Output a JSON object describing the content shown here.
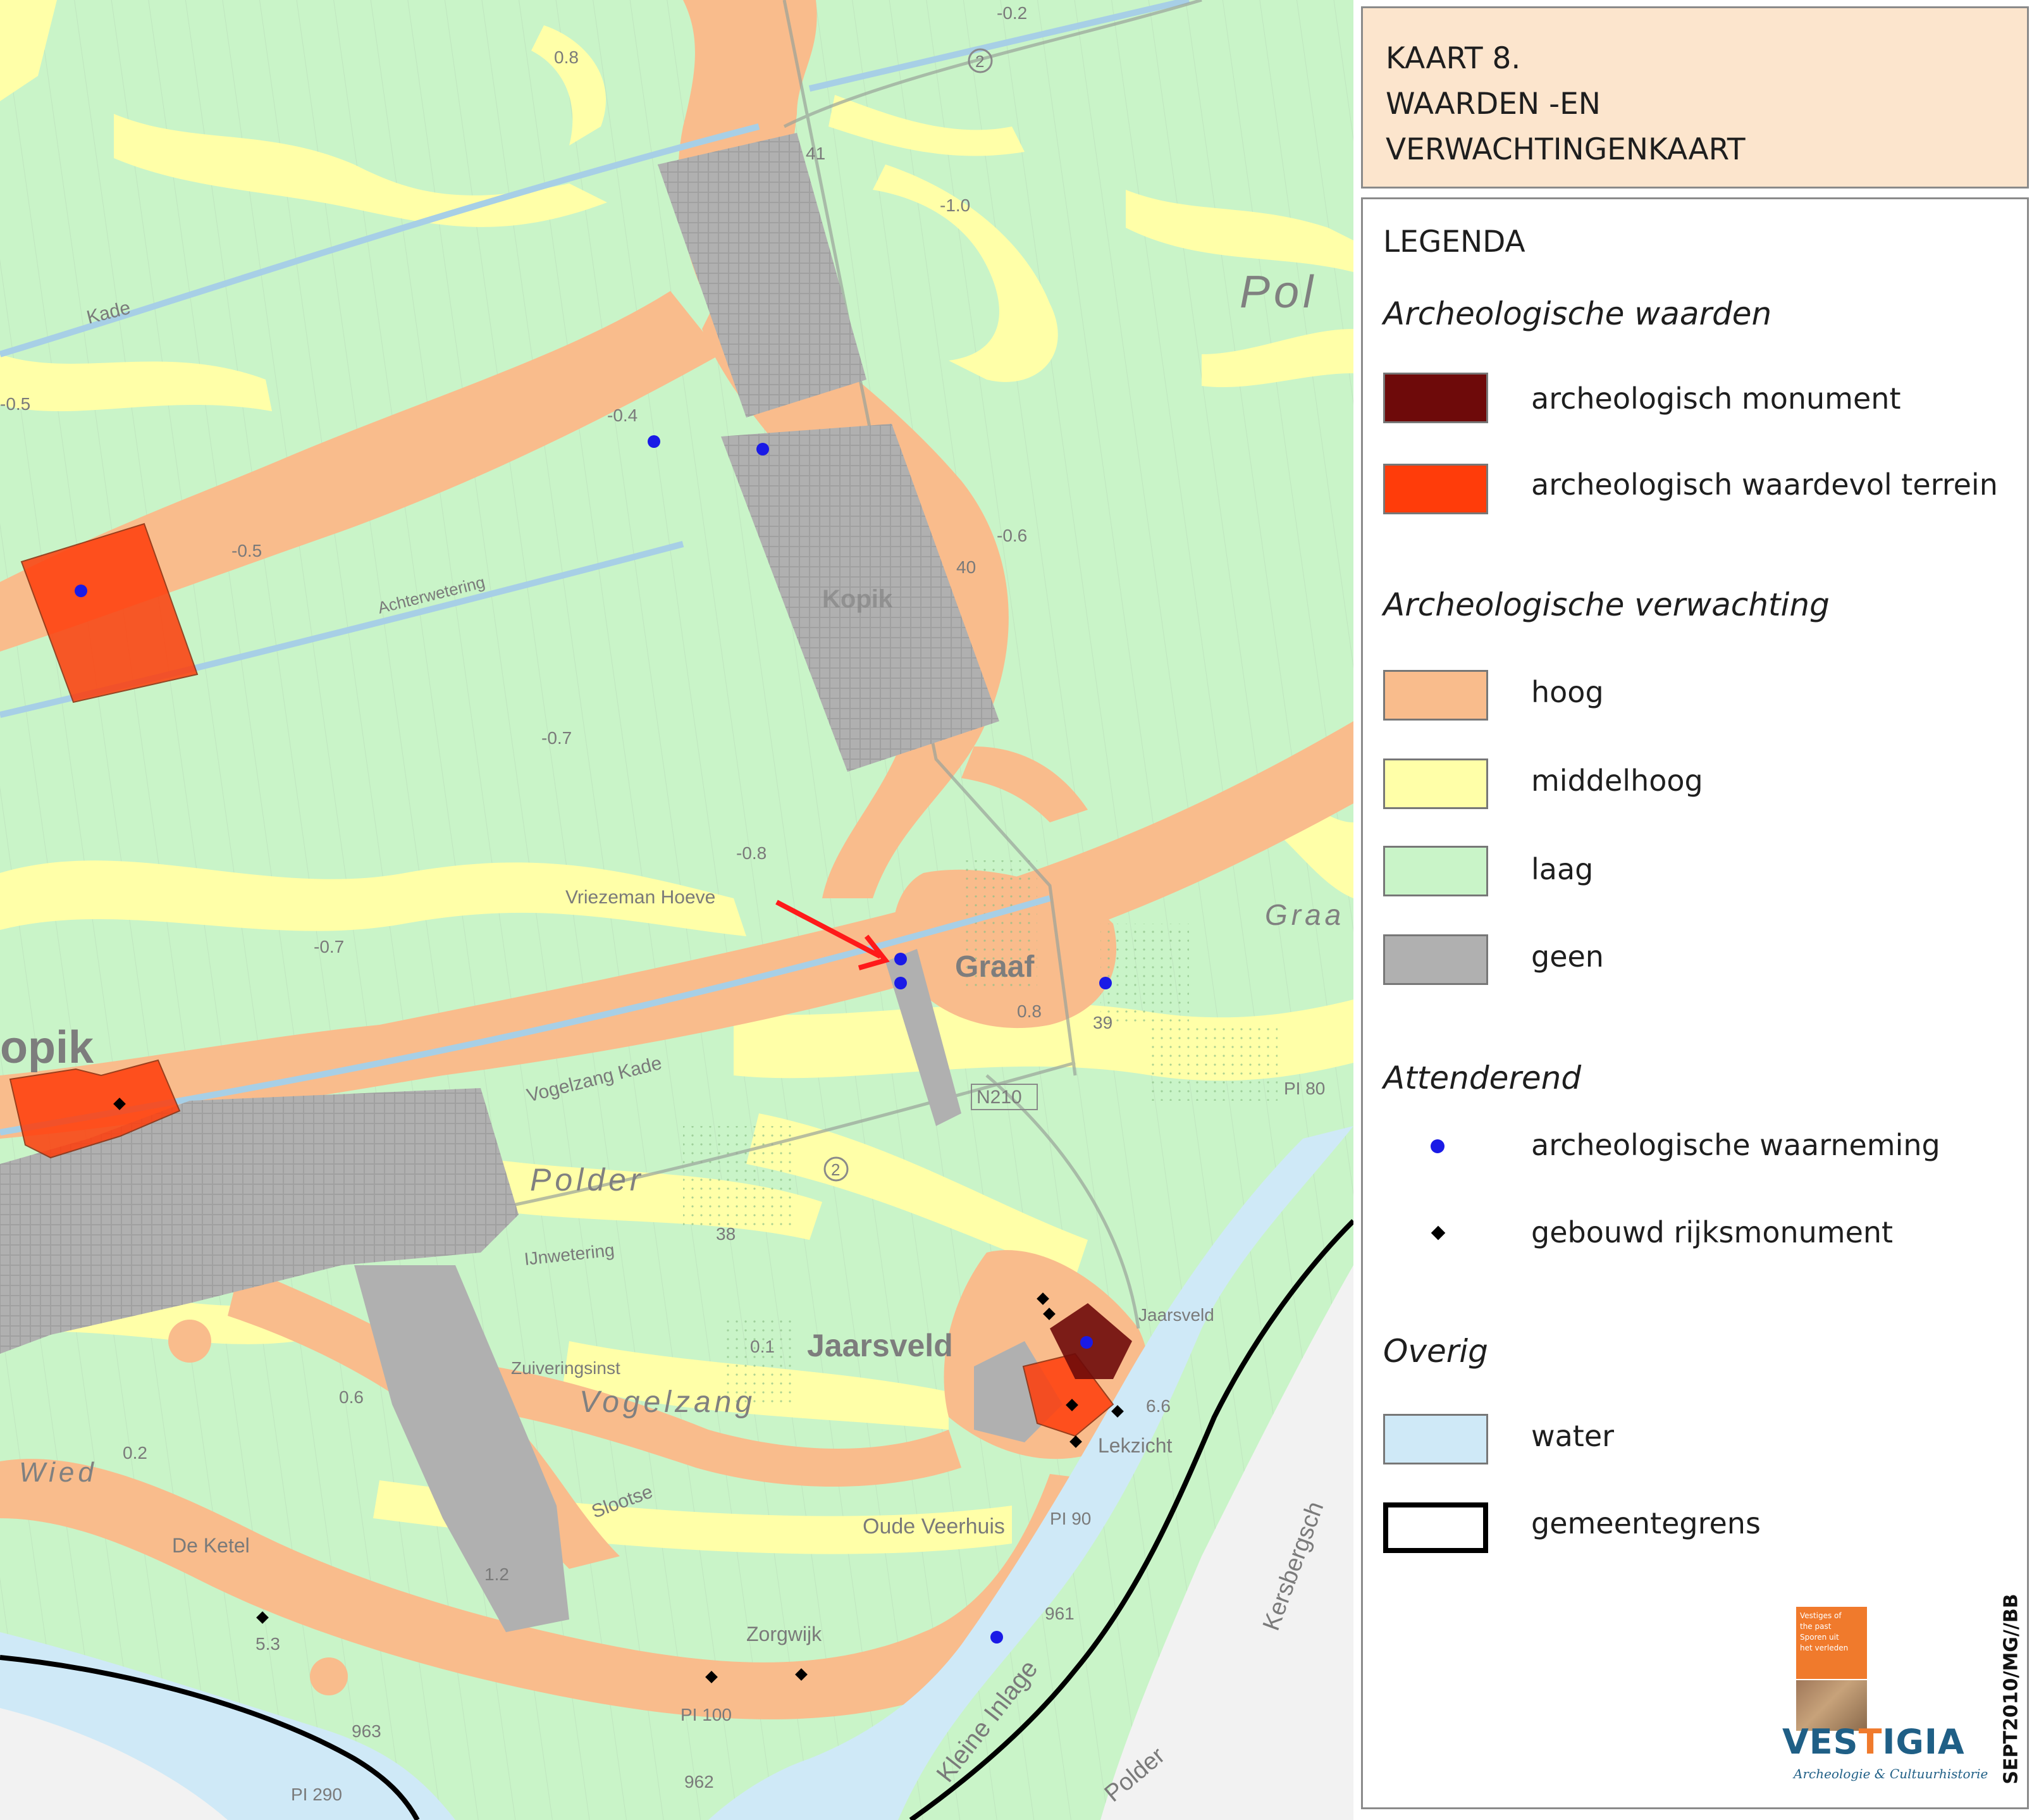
{
  "title": {
    "lines": [
      "KAART 8.",
      "WAARDEN -EN",
      "VERWACHTINGENKAART"
    ]
  },
  "legend": {
    "heading": "LEGENDA",
    "sections": [
      {
        "title": "Archeologische waarden",
        "items": [
          {
            "label": "archeologisch monument",
            "swatch": "#6e0a0a"
          },
          {
            "label": "archeologisch waardevol terrein",
            "swatch": "#ff3c0a"
          }
        ]
      },
      {
        "title": "Archeologische verwachting",
        "items": [
          {
            "label": "hoog",
            "swatch": "#f9bc8c"
          },
          {
            "label": "middelhoog",
            "swatch": "#ffffa8"
          },
          {
            "label": "laag",
            "swatch": "#c9f4c8"
          },
          {
            "label": "geen",
            "swatch": "#b0b0b0"
          }
        ]
      },
      {
        "title": "Attenderend",
        "items": [
          {
            "label": "archeologische waarneming",
            "marker": "dot",
            "color": "#1a1ae6"
          },
          {
            "label": "gebouwd rijksmonument",
            "marker": "diamond",
            "color": "#000000"
          }
        ]
      },
      {
        "title": "Overig",
        "items": [
          {
            "label": "water",
            "swatch": "#cfe9f7"
          },
          {
            "label": "gemeentegrens",
            "swatch": "#ffffff",
            "style": "thick-black-border"
          }
        ]
      }
    ]
  },
  "credit": "SEPT2010/MG//BB",
  "logo": {
    "card_lines": [
      "Vestiges of",
      "the past",
      "Sporen uit",
      "het verleden"
    ],
    "word_pre": "VES",
    "word_mark": "T",
    "word_post": "IGIA",
    "tagline": "Archeologie & Cultuurhistorie"
  },
  "map": {
    "colors": {
      "laag": "#c9f4c8",
      "middelhoog": "#ffffa8",
      "hoog": "#f9bc8c",
      "geen": "#b0b0b0",
      "waardevol": "#ff3c0a",
      "monument": "#6e0a0a",
      "water": "#cfe9f7",
      "grens": "#000000",
      "waarneming": "#1a1ae6",
      "pointer_arrow": "#ff1a1a"
    },
    "labels": {
      "kade": "Kade",
      "polder_ne": "Pol",
      "kopik": "Kopik",
      "lopik": "opik",
      "graaf": "Graaf",
      "graaf_e": "Graa",
      "vriezeman": "Vriezeman Hoeve",
      "polder": "Polder",
      "vogelzang_kade": "Vogelzang Kade",
      "jaarsveld": "Jaarsveld",
      "jaarsveld_small": "Jaarsveld",
      "vogelzang": "Vogelzang",
      "zuiveringsinst": "Zuiveringsinst",
      "lekzicht": "Lekzicht",
      "oude_veerhuis": "Oude Veerhuis",
      "de_ketel": "De Ketel",
      "zorgwijk": "Zorgwijk",
      "wied": "Wied",
      "slootse": "Slootse",
      "kleine_inlage": "Kleine Inlage",
      "polder_se": "Polder",
      "kersbergsche": "Kersbergsch",
      "n210": "N210",
      "ijnwetering": "IJnwetering",
      "ackterwetering": "Achterwetering",
      "pl90": "PI 90",
      "pl80": "PI 80",
      "pl100": "PI 100",
      "pl290": "PI 290",
      "km961": "961",
      "km962": "962",
      "km963": "963",
      "v_m02": "-0.2",
      "v_m04": "-0.4",
      "v_m05": "-0.5",
      "v_m05b": "-0.5",
      "v_m06": "-0.6",
      "v_m07": "-0.7",
      "v_m07b": "-0.7",
      "v_m08": "-0.8",
      "v_m10": "-1.0",
      "v_08": "0.8",
      "v_06": "0.6",
      "v_01": "0.1",
      "v_02": "0.2",
      "v_12": "1.2",
      "v_66": "6.6",
      "v_40": "40",
      "v_39": "39",
      "v_38": "38",
      "v_41": "41",
      "v_53": "5.3",
      "v_08b": "0.8",
      "road2a": "2",
      "road2b": "2"
    }
  }
}
